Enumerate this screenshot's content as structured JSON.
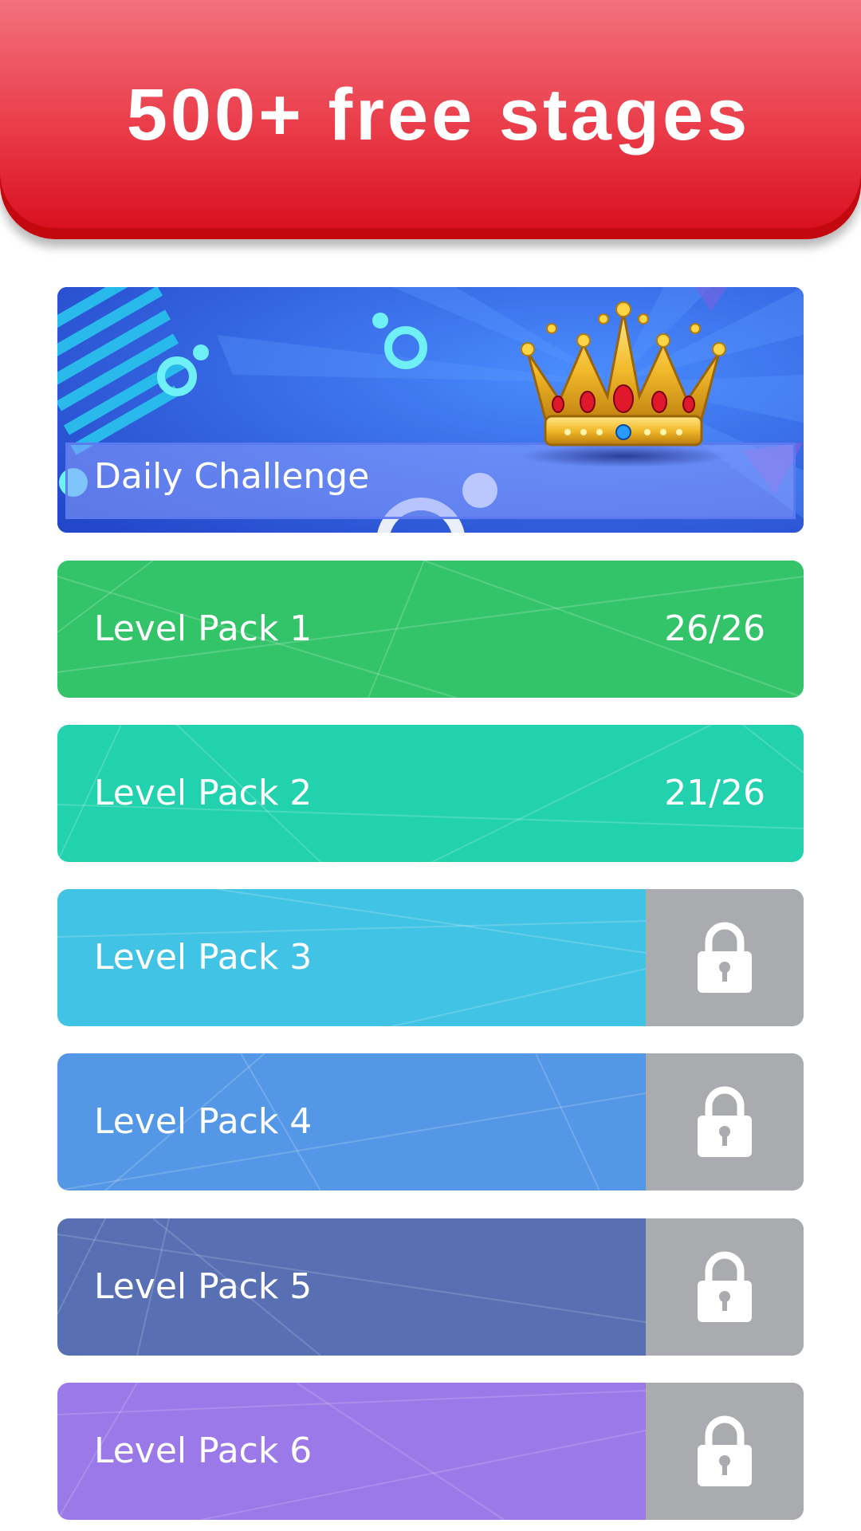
{
  "header": {
    "title": "500+ free stages"
  },
  "daily_challenge": {
    "label": "Daily Challenge",
    "icon": "crown-icon"
  },
  "packs": [
    {
      "label": "Level Pack 1",
      "progress": "26/26",
      "locked": false,
      "color": "#33c46a"
    },
    {
      "label": "Level Pack 2",
      "progress": "21/26",
      "locked": false,
      "color": "#22d1ae"
    },
    {
      "label": "Level Pack 3",
      "progress": "",
      "locked": true,
      "color": "#41c3e6"
    },
    {
      "label": "Level Pack 4",
      "progress": "",
      "locked": true,
      "color": "#5497e6"
    },
    {
      "label": "Level Pack 5",
      "progress": "",
      "locked": true,
      "color": "#5870b3"
    },
    {
      "label": "Level Pack 6",
      "progress": "",
      "locked": true,
      "color": "#9b79e8"
    }
  ],
  "colors": {
    "header_red": "#e52a39",
    "lock_gray": "#a9abaf",
    "daily_blue": "#2c5ad6"
  }
}
